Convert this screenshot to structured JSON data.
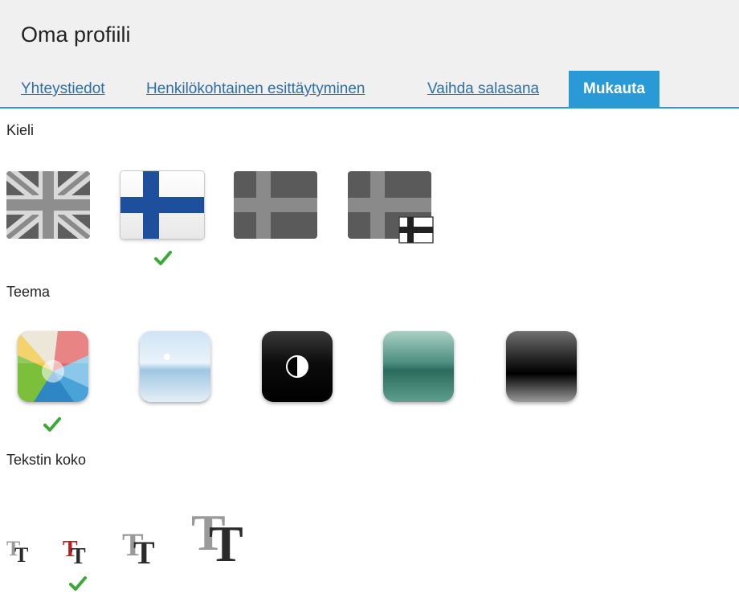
{
  "header": {
    "title": "Oma profiili"
  },
  "tabs": [
    {
      "label": "Yhteystiedot",
      "active": false
    },
    {
      "label": "Henkilökohtainen esittäytyminen",
      "active": false
    },
    {
      "label": "Vaihda salasana",
      "active": false
    },
    {
      "label": "Mukauta",
      "active": true
    }
  ],
  "language": {
    "label": "Kieli",
    "options": [
      {
        "icon": "uk-flag-icon",
        "selected": false
      },
      {
        "icon": "finland-flag-icon",
        "selected": true
      },
      {
        "icon": "sweden-flag-icon",
        "selected": false
      },
      {
        "icon": "sweden-finland-flag-icon",
        "selected": false
      }
    ]
  },
  "theme": {
    "label": "Teema",
    "options": [
      {
        "icon": "colorful-theme-icon",
        "selected": true
      },
      {
        "icon": "sky-theme-icon",
        "selected": false
      },
      {
        "icon": "high-contrast-theme-icon",
        "selected": false
      },
      {
        "icon": "green-theme-icon",
        "selected": false
      },
      {
        "icon": "dark-theme-icon",
        "selected": false
      }
    ]
  },
  "text_size": {
    "label": "Tekstin koko",
    "options": [
      {
        "icon": "text-size-small-icon",
        "selected": false
      },
      {
        "icon": "text-size-medium-icon",
        "selected": true
      },
      {
        "icon": "text-size-large-icon",
        "selected": false
      },
      {
        "icon": "text-size-xlarge-icon",
        "selected": false
      }
    ]
  },
  "colors": {
    "accent": "#2a9ad6",
    "link": "#2d6fa5",
    "check": "#3aa935",
    "header_bg": "#f0f0f0"
  }
}
